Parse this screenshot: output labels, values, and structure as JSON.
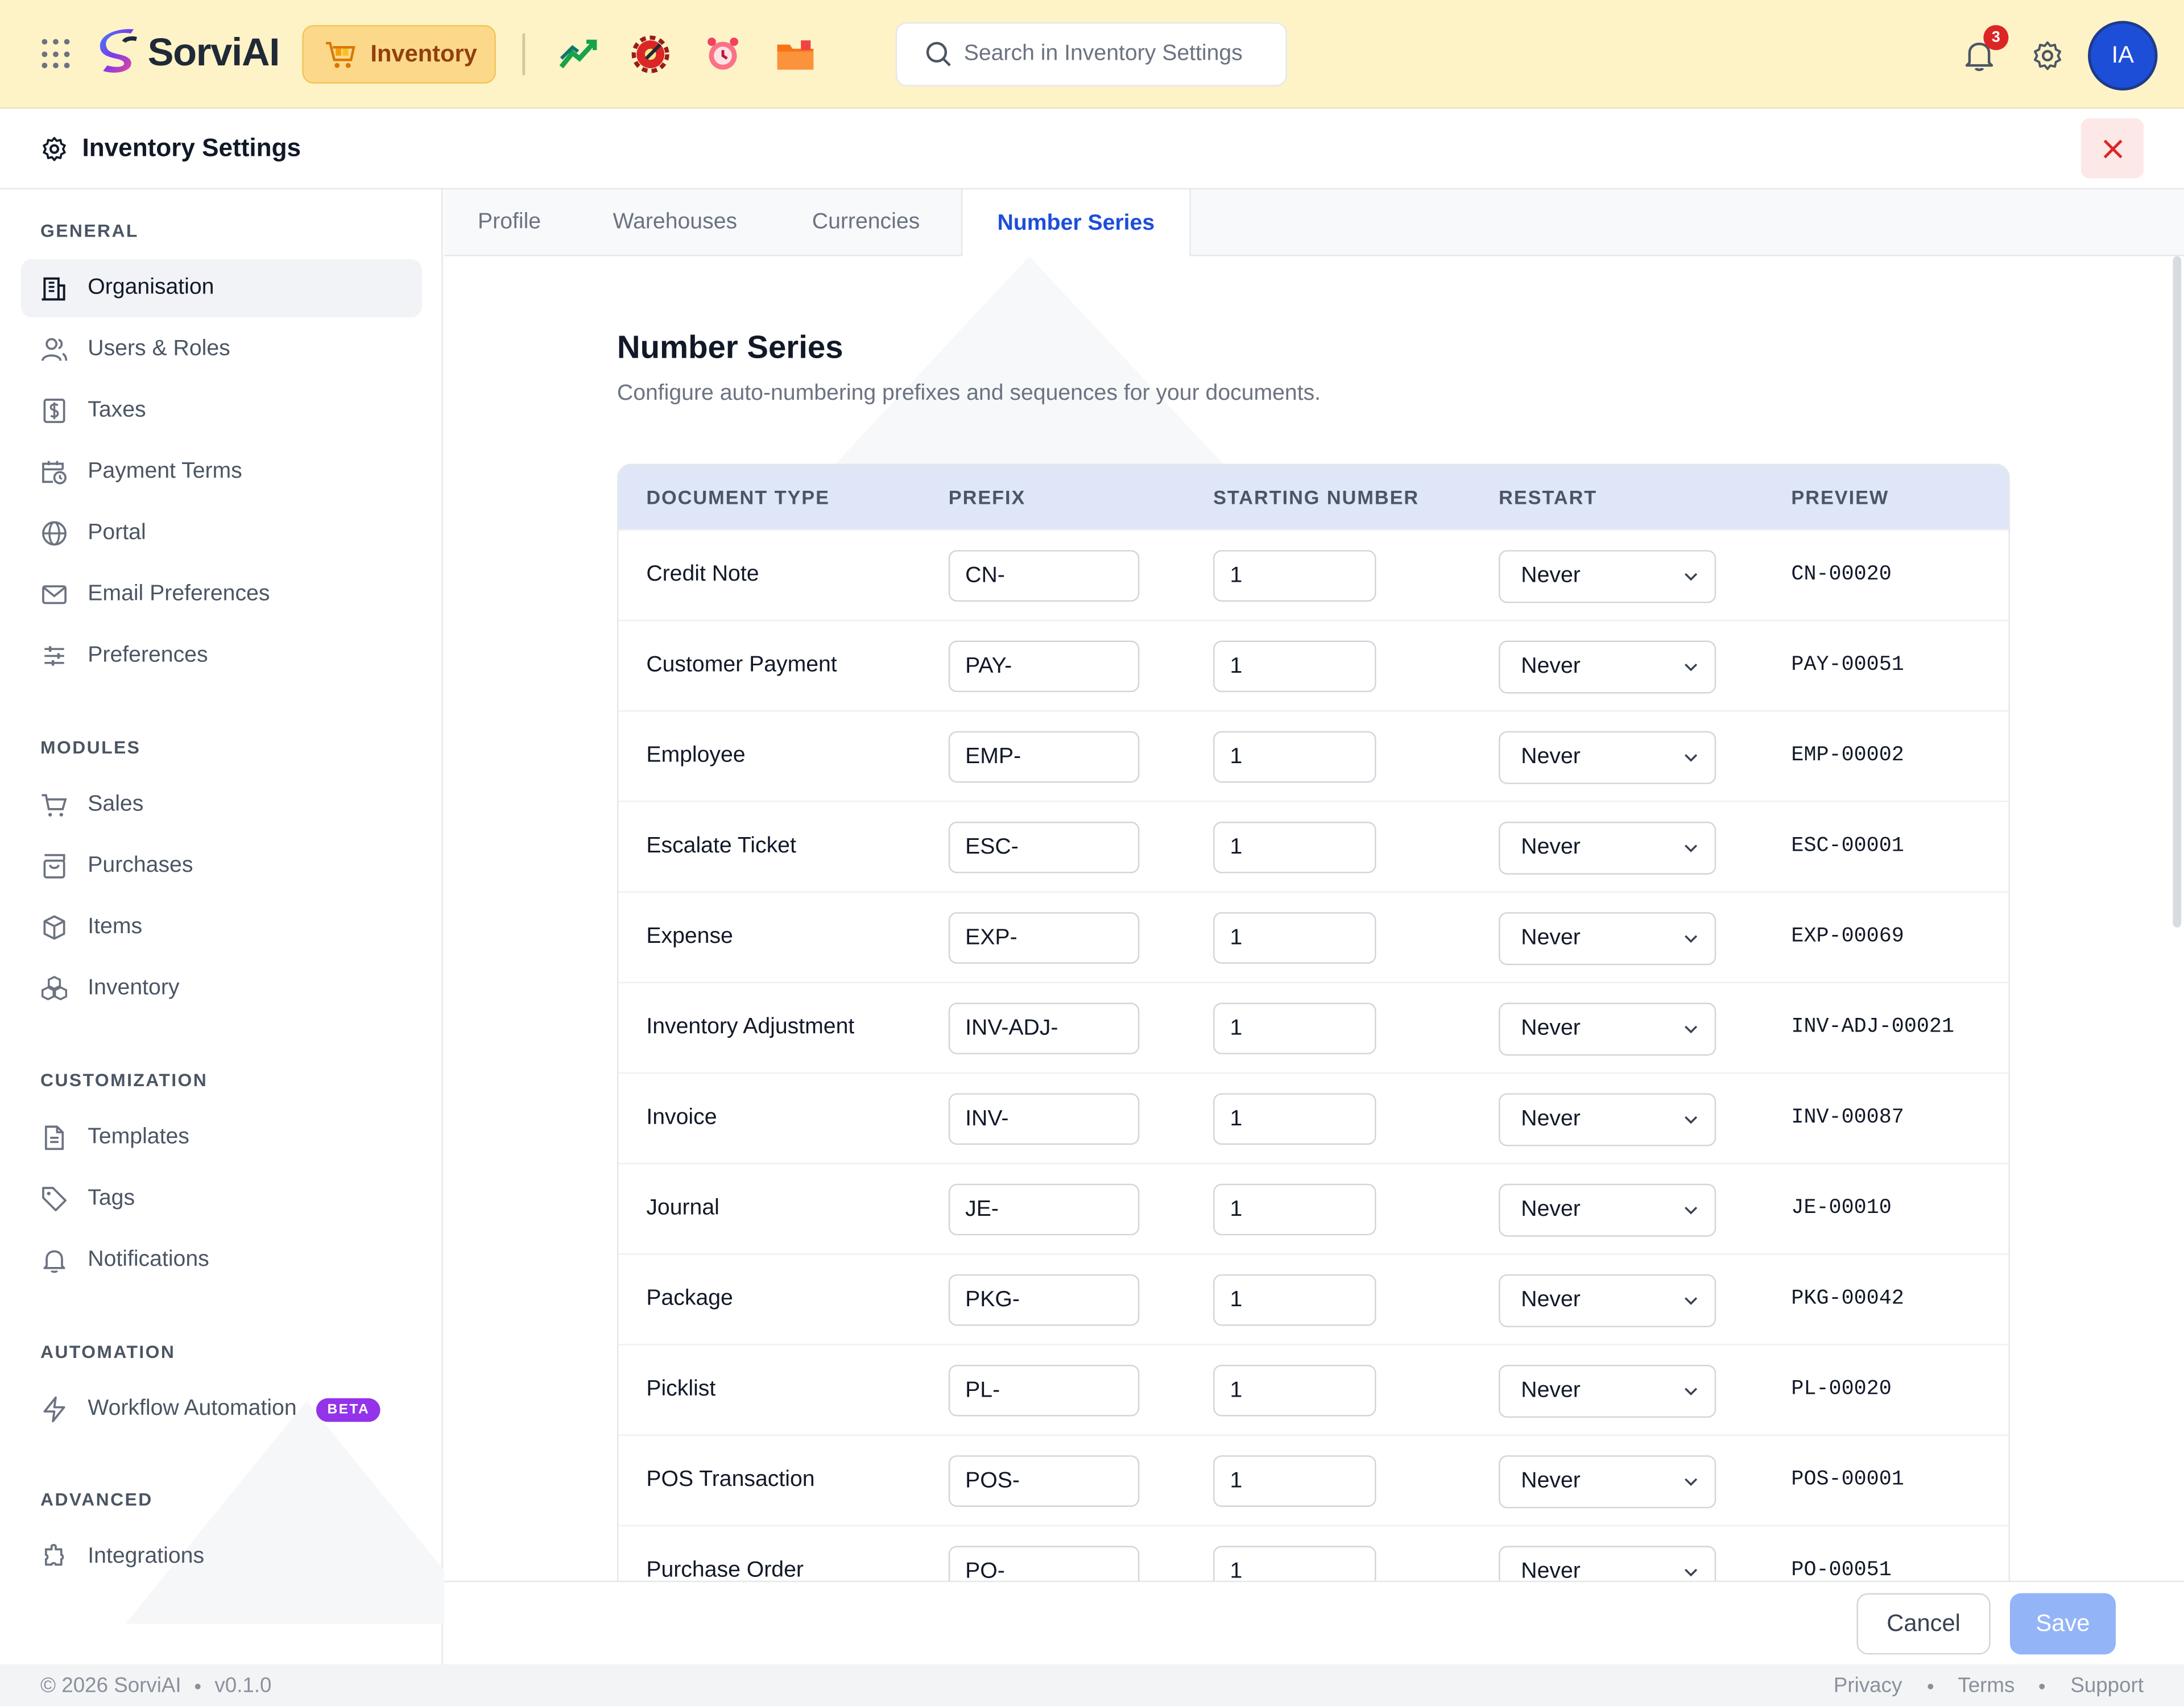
{
  "topbar": {
    "app_name": "SorviAI",
    "module_label": "Inventory",
    "search_placeholder": "Search in Inventory Settings",
    "notification_count": "3",
    "avatar_initials": "IA",
    "app_icons": [
      "chart-trend-icon",
      "gear-wrench-icon",
      "alarm-icon",
      "folder-icon"
    ]
  },
  "settings_header": {
    "title": "Inventory Settings"
  },
  "sidebar": {
    "sections": [
      {
        "title": "GENERAL",
        "items": [
          {
            "label": "Organisation",
            "icon": "building-icon",
            "active": true
          },
          {
            "label": "Users & Roles",
            "icon": "users-icon"
          },
          {
            "label": "Taxes",
            "icon": "tax-icon"
          },
          {
            "label": "Payment Terms",
            "icon": "calendar-clock-icon"
          },
          {
            "label": "Portal",
            "icon": "globe-icon"
          },
          {
            "label": "Email Preferences",
            "icon": "mail-icon"
          },
          {
            "label": "Preferences",
            "icon": "sliders-icon"
          }
        ]
      },
      {
        "title": "MODULES",
        "items": [
          {
            "label": "Sales",
            "icon": "cart-icon"
          },
          {
            "label": "Purchases",
            "icon": "bag-icon"
          },
          {
            "label": "Items",
            "icon": "box-icon"
          },
          {
            "label": "Inventory",
            "icon": "boxes-icon"
          }
        ]
      },
      {
        "title": "CUSTOMIZATION",
        "items": [
          {
            "label": "Templates",
            "icon": "file-icon"
          },
          {
            "label": "Tags",
            "icon": "tag-icon"
          },
          {
            "label": "Notifications",
            "icon": "bell-icon"
          }
        ]
      },
      {
        "title": "AUTOMATION",
        "items": [
          {
            "label": "Workflow Automation",
            "icon": "bolt-icon",
            "badge": "BETA"
          }
        ]
      },
      {
        "title": "ADVANCED",
        "items": [
          {
            "label": "Integrations",
            "icon": "puzzle-icon"
          }
        ]
      }
    ]
  },
  "tabs": [
    {
      "label": "Profile"
    },
    {
      "label": "Warehouses"
    },
    {
      "label": "Currencies"
    },
    {
      "label": "Number Series",
      "active": true
    }
  ],
  "main": {
    "title": "Number Series",
    "subtitle": "Configure auto-numbering prefixes and sequences for your documents.",
    "columns": [
      "DOCUMENT TYPE",
      "PREFIX",
      "STARTING NUMBER",
      "RESTART",
      "PREVIEW"
    ],
    "rows": [
      {
        "type": "Credit Note",
        "prefix": "CN-",
        "start": "1",
        "restart": "Never",
        "preview": "CN-00020"
      },
      {
        "type": "Customer Payment",
        "prefix": "PAY-",
        "start": "1",
        "restart": "Never",
        "preview": "PAY-00051"
      },
      {
        "type": "Employee",
        "prefix": "EMP-",
        "start": "1",
        "restart": "Never",
        "preview": "EMP-00002"
      },
      {
        "type": "Escalate Ticket",
        "prefix": "ESC-",
        "start": "1",
        "restart": "Never",
        "preview": "ESC-00001"
      },
      {
        "type": "Expense",
        "prefix": "EXP-",
        "start": "1",
        "restart": "Never",
        "preview": "EXP-00069"
      },
      {
        "type": "Inventory Adjustment",
        "prefix": "INV-ADJ-",
        "start": "1",
        "restart": "Never",
        "preview": "INV-ADJ-00021"
      },
      {
        "type": "Invoice",
        "prefix": "INV-",
        "start": "1",
        "restart": "Never",
        "preview": "INV-00087"
      },
      {
        "type": "Journal",
        "prefix": "JE-",
        "start": "1",
        "restart": "Never",
        "preview": "JE-00010"
      },
      {
        "type": "Package",
        "prefix": "PKG-",
        "start": "1",
        "restart": "Never",
        "preview": "PKG-00042"
      },
      {
        "type": "Picklist",
        "prefix": "PL-",
        "start": "1",
        "restart": "Never",
        "preview": "PL-00020"
      },
      {
        "type": "POS Transaction",
        "prefix": "POS-",
        "start": "1",
        "restart": "Never",
        "preview": "POS-00001"
      },
      {
        "type": "Purchase Order",
        "prefix": "PO-",
        "start": "1",
        "restart": "Never",
        "preview": "PO-00051"
      }
    ]
  },
  "actions": {
    "cancel_label": "Cancel",
    "save_label": "Save"
  },
  "footer": {
    "copyright": "© 2026 SorviAI",
    "version": "v0.1.0",
    "links": [
      "Privacy",
      "Terms",
      "Support"
    ]
  },
  "colors": {
    "topbar_bg": "#fef3c7",
    "accent": "#1d4ed8",
    "save_disabled": "#93b4f7",
    "beta_badge": "#9333ea",
    "table_header": "#dfe6f7"
  }
}
